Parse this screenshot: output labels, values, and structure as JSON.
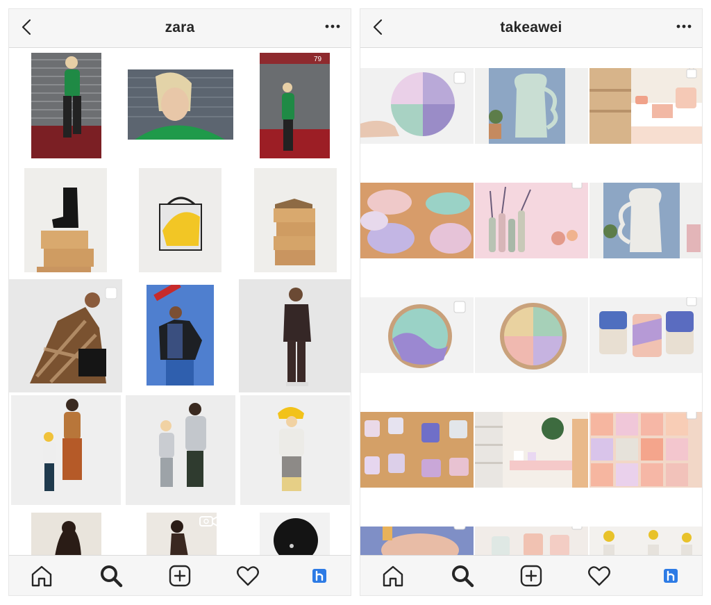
{
  "screens": [
    {
      "profile_name": "zara",
      "tabs": [
        "home-icon",
        "search-icon",
        "new-post-icon",
        "activity-heart-icon",
        "hootsuite-icon"
      ]
    },
    {
      "profile_name": "takeawei",
      "tabs": [
        "home-icon",
        "search-icon",
        "new-post-icon",
        "activity-heart-icon",
        "hootsuite-icon"
      ]
    }
  ],
  "colors": {
    "text": "#262626",
    "header_bg": "#f6f6f6",
    "divider": "#dbdbdb",
    "hootsuite_blue": "#2d7be5"
  }
}
